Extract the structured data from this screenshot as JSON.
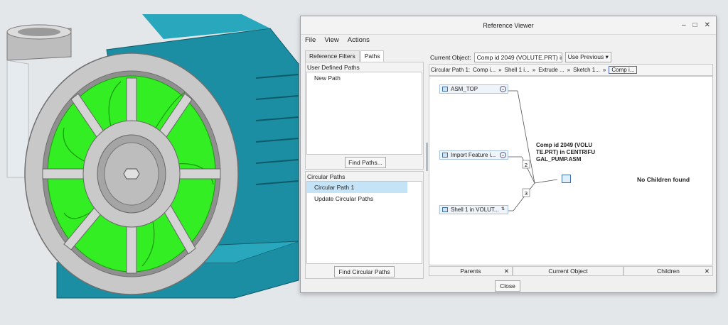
{
  "window": {
    "title": "Reference Viewer",
    "minimize": "–",
    "maximize": "□",
    "close": "✕"
  },
  "menu": [
    "File",
    "View",
    "Actions"
  ],
  "tabs": [
    "Reference Filters",
    "Paths"
  ],
  "user_paths": {
    "title": "User Defined Paths",
    "items": [
      "New Path"
    ],
    "button": "Find Paths..."
  },
  "circular_paths": {
    "title": "Circular Paths",
    "items": [
      "Circular Path 1",
      "Update Circular Paths"
    ],
    "button": "Find Circular Paths"
  },
  "current_object": {
    "label": "Current Object:",
    "value": "Comp id 2049 (VOLUTE.PRT) in",
    "option": "Use Previous"
  },
  "breadcrumb": {
    "label": "Circular Path 1:",
    "items": [
      "Comp i...",
      "Shell 1 i...",
      "Extrude ...",
      "Sketch 1...",
      "Comp i..."
    ]
  },
  "graph": {
    "parents": [
      "ASM_TOP",
      "Import Feature i...",
      "Shell 1 in VOLUT..."
    ],
    "current": [
      "Comp id 2049 (VOLU",
      "TE.PRT) in CENTRIFU",
      "GAL_PUMP.ASM"
    ],
    "edge_labels": [
      "2",
      "3"
    ],
    "no_children": "No Children found"
  },
  "footer": {
    "parents": "Parents",
    "current": "Current Object",
    "children": "Children",
    "x": "✕"
  },
  "close_button": "Close",
  "colors": {
    "impeller": "#33ee22",
    "base": "#1b8ea3",
    "housing": "#c8c8c8",
    "selection": "#c5e3f7"
  }
}
